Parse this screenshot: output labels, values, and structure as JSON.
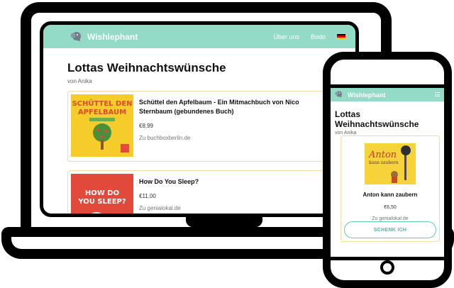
{
  "app": {
    "brand": "Wishlephant",
    "nav_links": [
      "Über uns",
      "Bodo"
    ],
    "flag": "de",
    "flag_colors": [
      "#000000",
      "#dd0000",
      "#ffce00"
    ],
    "accent": "#94dbc7"
  },
  "list": {
    "title": "Lottas Weihnachtswünsche",
    "owner": "von Anika"
  },
  "desktop_items": [
    {
      "name": "Schüttel den Apfelbaum - Ein Mitmachbuch von Nico Sternbaum (gebundenes Buch)",
      "price": "€8,99",
      "shop": "Zu buchboxberlin.de",
      "cover_text": "SCHÜTTEL DEN APFELBAUM"
    },
    {
      "name": "How Do You Sleep?",
      "price": "€11,00",
      "shop": "Zu genialokal.de",
      "cover_text": "HOW DO YOU SLEEP?"
    }
  ],
  "mobile_item": {
    "name": "Anton kann zaubern",
    "price": "€6,50",
    "shop": "Zu genialokal.de",
    "cover_title": "Anton",
    "cover_subtitle": "kann zaubern",
    "button": "SCHENK ICH"
  },
  "icons": {
    "edit": "pencil-icon",
    "delete": "trash-icon",
    "menu": "hamburger-icon",
    "logo": "elephant-icon"
  }
}
